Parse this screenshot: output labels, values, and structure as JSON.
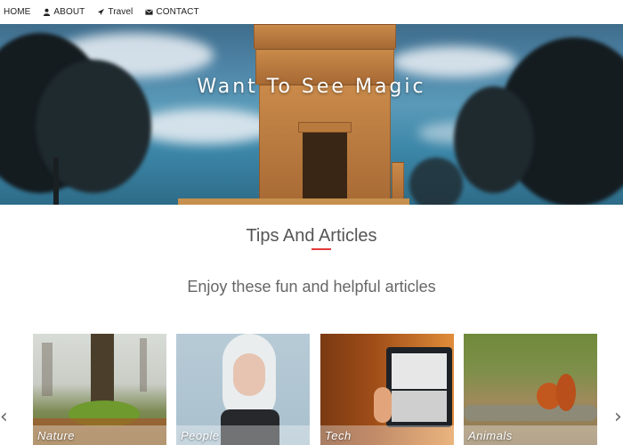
{
  "nav": {
    "items": [
      {
        "label": "HOME",
        "icon": "none"
      },
      {
        "label": "ABOUT",
        "icon": "user-icon"
      },
      {
        "label": "Travel",
        "icon": "plane-icon"
      },
      {
        "label": "CONTACT",
        "icon": "envelope-icon"
      }
    ]
  },
  "hero": {
    "title": "Want To See Magic"
  },
  "section": {
    "title": "Tips And Articles",
    "subtitle": "Enjoy these fun and helpful articles",
    "accent_color": "#e23b3b"
  },
  "carousel": {
    "prev_icon": "chevron-left-icon",
    "next_icon": "chevron-right-icon",
    "cards": [
      {
        "label": "Nature"
      },
      {
        "label": "People"
      },
      {
        "label": "Tech"
      },
      {
        "label": "Animals"
      }
    ]
  }
}
